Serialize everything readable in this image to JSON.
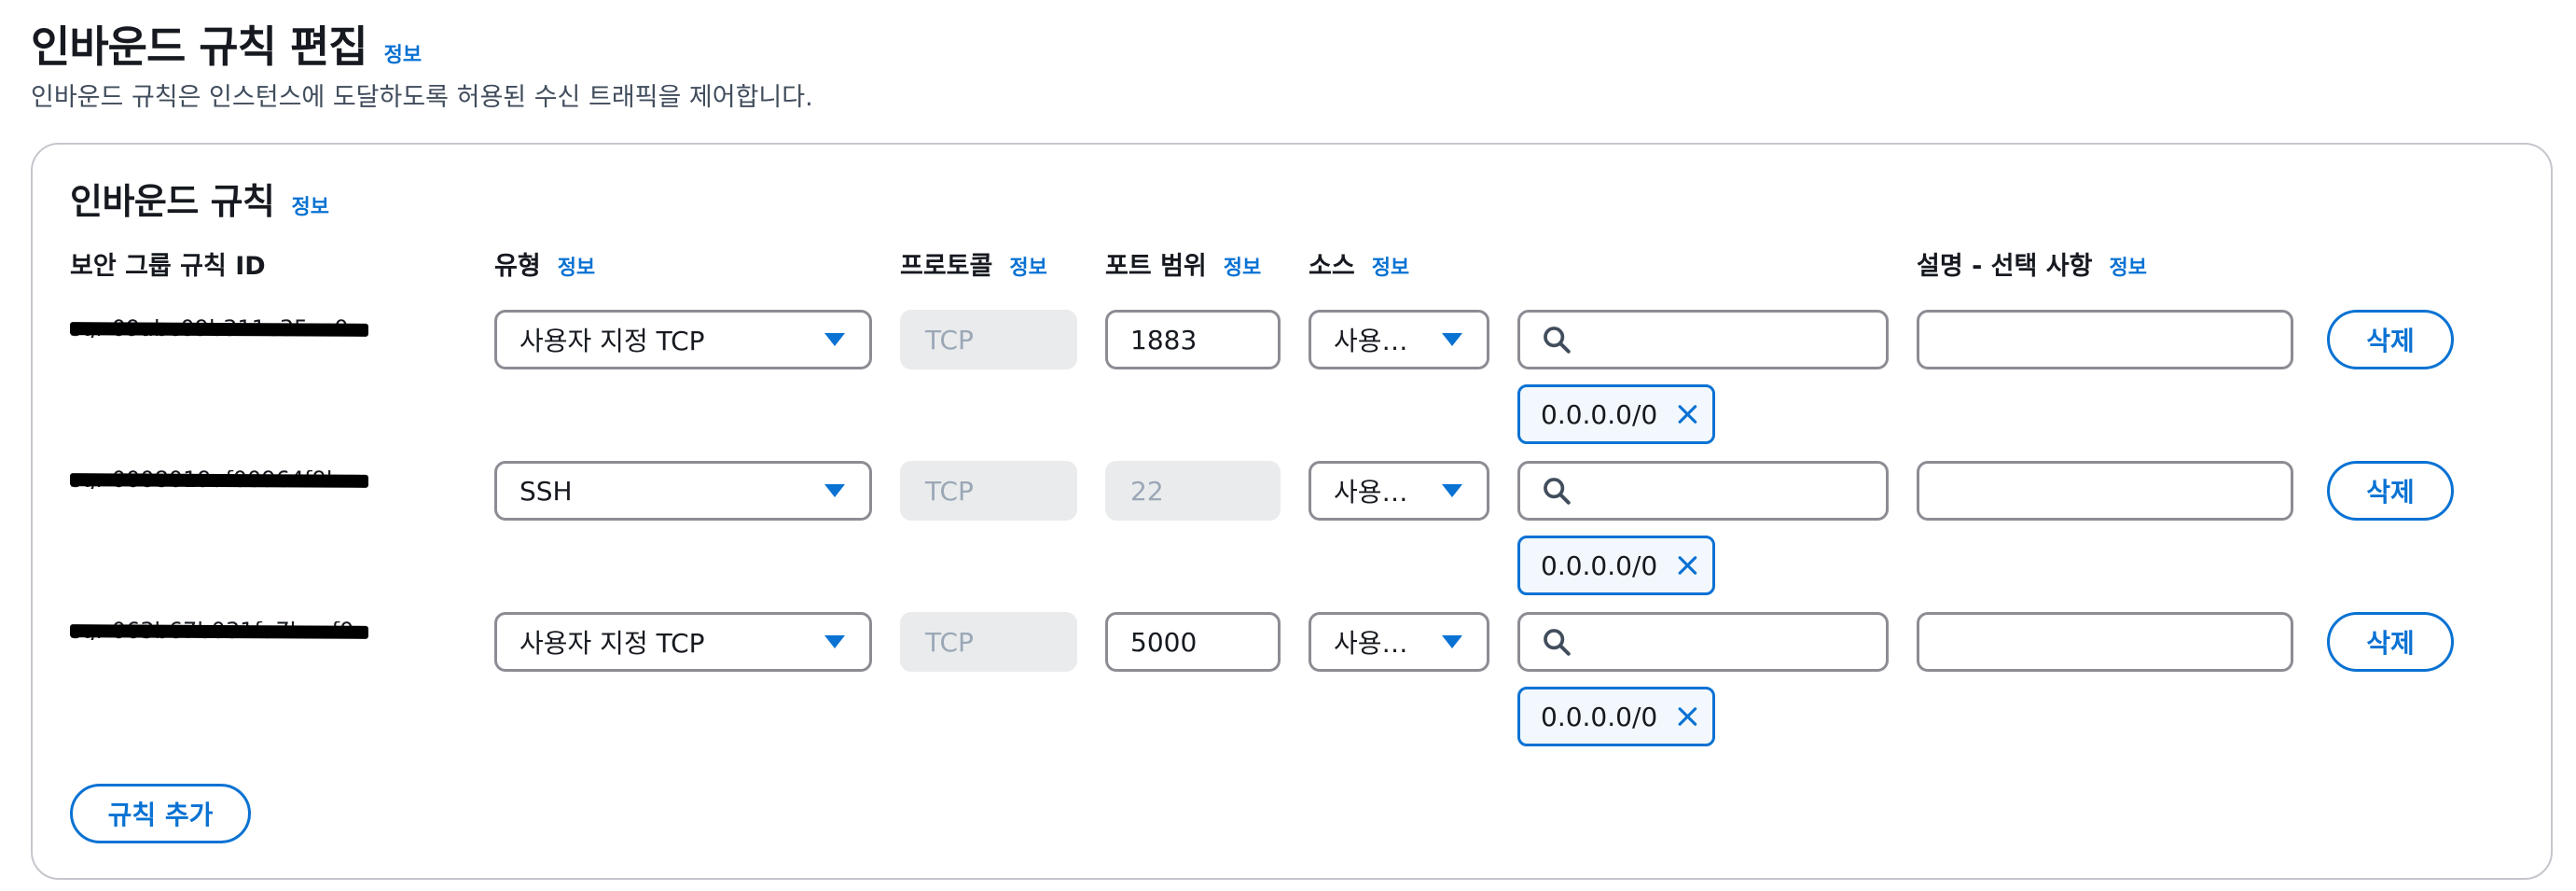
{
  "header": {
    "title": "인바운드 규칙 편집",
    "info": "정보",
    "description": "인바운드 규칙은 인스턴스에 도달하도록 허용된 수신 트래픽을 제어합니다."
  },
  "section": {
    "title": "인바운드 규칙",
    "info": "정보"
  },
  "columns": {
    "rule_id": "보안 그룹 규칙 ID",
    "type": "유형",
    "type_info": "정보",
    "protocol": "프로토콜",
    "protocol_info": "정보",
    "port": "포트 범위",
    "port_info": "정보",
    "source": "소스",
    "source_info": "정보",
    "description": "설명 - 선택 사항",
    "description_info": "정보"
  },
  "rules": [
    {
      "id": "sgr-09abc09b311e35ec0",
      "type": "사용자 지정 TCP",
      "protocol": "TCP",
      "port": "1883",
      "source": "사용…",
      "search": "",
      "cidr": "0.0.0.0/0",
      "description": "",
      "delete": "삭제"
    },
    {
      "id": "sgr-0008019af00964f9b",
      "type": "SSH",
      "protocol": "TCP",
      "port": "22",
      "source": "사용…",
      "search": "",
      "cidr": "0.0.0.0/0",
      "description": "",
      "delete": "삭제"
    },
    {
      "id": "sgr-063b67b031fa7baef0",
      "type": "사용자 지정 TCP",
      "protocol": "TCP",
      "port": "5000",
      "source": "사용…",
      "search": "",
      "cidr": "0.0.0.0/0",
      "description": "",
      "delete": "삭제"
    }
  ],
  "add_rule": "규칙 추가",
  "colors": {
    "accent": "#0972d3",
    "border": "#8c8c94",
    "disabled_bg": "#e9ebed",
    "text": "#16191f"
  },
  "icons": {
    "dropdown": "caret-down-icon",
    "search": "search-icon",
    "remove": "close-icon"
  }
}
